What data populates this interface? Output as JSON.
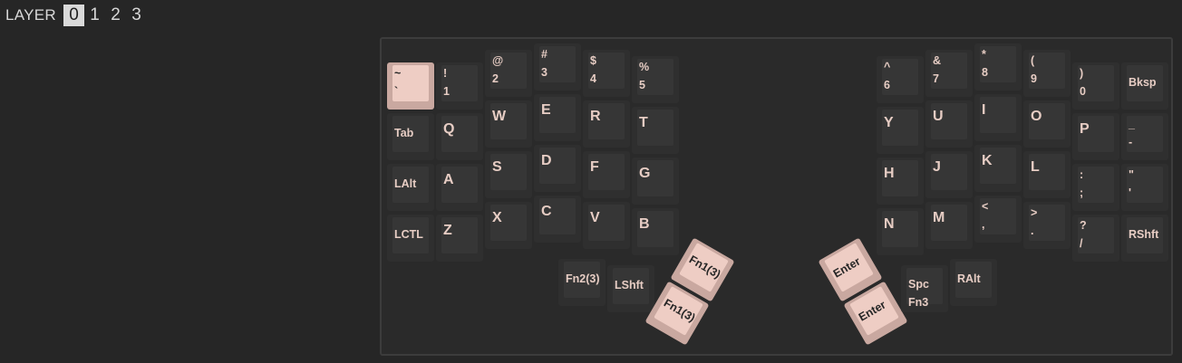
{
  "layer_bar": {
    "label": "LAYER",
    "tabs": [
      "0",
      "1",
      "2",
      "3"
    ],
    "active": "0"
  },
  "keys": {
    "left": {
      "row0": [
        {
          "top": "~",
          "bottom": "`"
        },
        {
          "top": "!",
          "bottom": "1"
        },
        {
          "top": "@",
          "bottom": "2"
        },
        {
          "top": "#",
          "bottom": "3"
        },
        {
          "top": "$",
          "bottom": "4"
        },
        {
          "top": "%",
          "bottom": "5"
        }
      ],
      "row1": [
        "Tab",
        "Q",
        "W",
        "E",
        "R",
        "T"
      ],
      "row2": [
        "LAlt",
        "A",
        "S",
        "D",
        "F",
        "G"
      ],
      "row3": [
        "LCTL",
        "Z",
        "X",
        "C",
        "V",
        "B"
      ],
      "thumb": [
        "Fn2(3)",
        "LShft",
        "Fn1(3)",
        "Fn1(3)"
      ]
    },
    "right": {
      "row0": [
        {
          "top": "^",
          "bottom": "6"
        },
        {
          "top": "&",
          "bottom": "7"
        },
        {
          "top": "*",
          "bottom": "8"
        },
        {
          "top": "(",
          "bottom": "9"
        },
        {
          "top": ")",
          "bottom": "0"
        },
        {
          "top": "",
          "bottom": "Bksp"
        }
      ],
      "row1": [
        {
          "top": "",
          "bottom": "Y"
        },
        {
          "top": "",
          "bottom": "U"
        },
        {
          "top": "",
          "bottom": "I"
        },
        {
          "top": "",
          "bottom": "O"
        },
        {
          "top": "",
          "bottom": "P"
        },
        {
          "top": "_",
          "bottom": "-"
        }
      ],
      "row2": [
        {
          "top": "",
          "bottom": "H"
        },
        {
          "top": "",
          "bottom": "J"
        },
        {
          "top": "",
          "bottom": "K"
        },
        {
          "top": "",
          "bottom": "L"
        },
        {
          "top": ":",
          "bottom": ";"
        },
        {
          "top": "\"",
          "bottom": "'"
        }
      ],
      "row3": [
        {
          "top": "",
          "bottom": "N"
        },
        {
          "top": "",
          "bottom": "M"
        },
        {
          "top": "<",
          "bottom": ","
        },
        {
          "top": ">",
          "bottom": "."
        },
        {
          "top": "?",
          "bottom": "/"
        },
        {
          "top": "",
          "bottom": "RShft"
        }
      ],
      "thumb": [
        "Enter",
        "Enter",
        "Spc",
        "Fn3",
        "RAlt"
      ]
    }
  },
  "colors": {
    "background": "#262626",
    "board": "#2a2a2a",
    "key": "#363636",
    "legend": "#e7cdc4",
    "highlight": "#eecdc4"
  }
}
